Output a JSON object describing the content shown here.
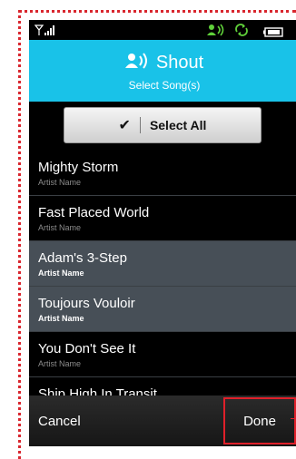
{
  "status_bar": {
    "icons": [
      "signal-icon",
      "shout-status-icon",
      "sync-icon",
      "battery-icon"
    ]
  },
  "header": {
    "title": "Shout",
    "subtitle": "Select Song(s)",
    "icon": "shout-icon",
    "background_color": "#19c2e8"
  },
  "select_all": {
    "label": "Select All",
    "icon": "checkmark-icon"
  },
  "songs": [
    {
      "title": "Mighty Storm",
      "artist": "Artist Name",
      "selected": false
    },
    {
      "title": "Fast Placed World",
      "artist": "Artist Name",
      "selected": false
    },
    {
      "title": "Adam's 3-Step",
      "artist": "Artist Name",
      "selected": true
    },
    {
      "title": "Toujours Vouloir",
      "artist": "Artist Name",
      "selected": true
    },
    {
      "title": "You Don't See It",
      "artist": "Artist Name",
      "selected": false
    },
    {
      "title": "Ship High In Transit",
      "artist": "",
      "selected": false
    }
  ],
  "bottom_bar": {
    "cancel_label": "Cancel",
    "done_label": "Done"
  },
  "colors": {
    "accent": "#19c2e8",
    "selected_row": "#474f57",
    "annotation": "#e0202a"
  }
}
